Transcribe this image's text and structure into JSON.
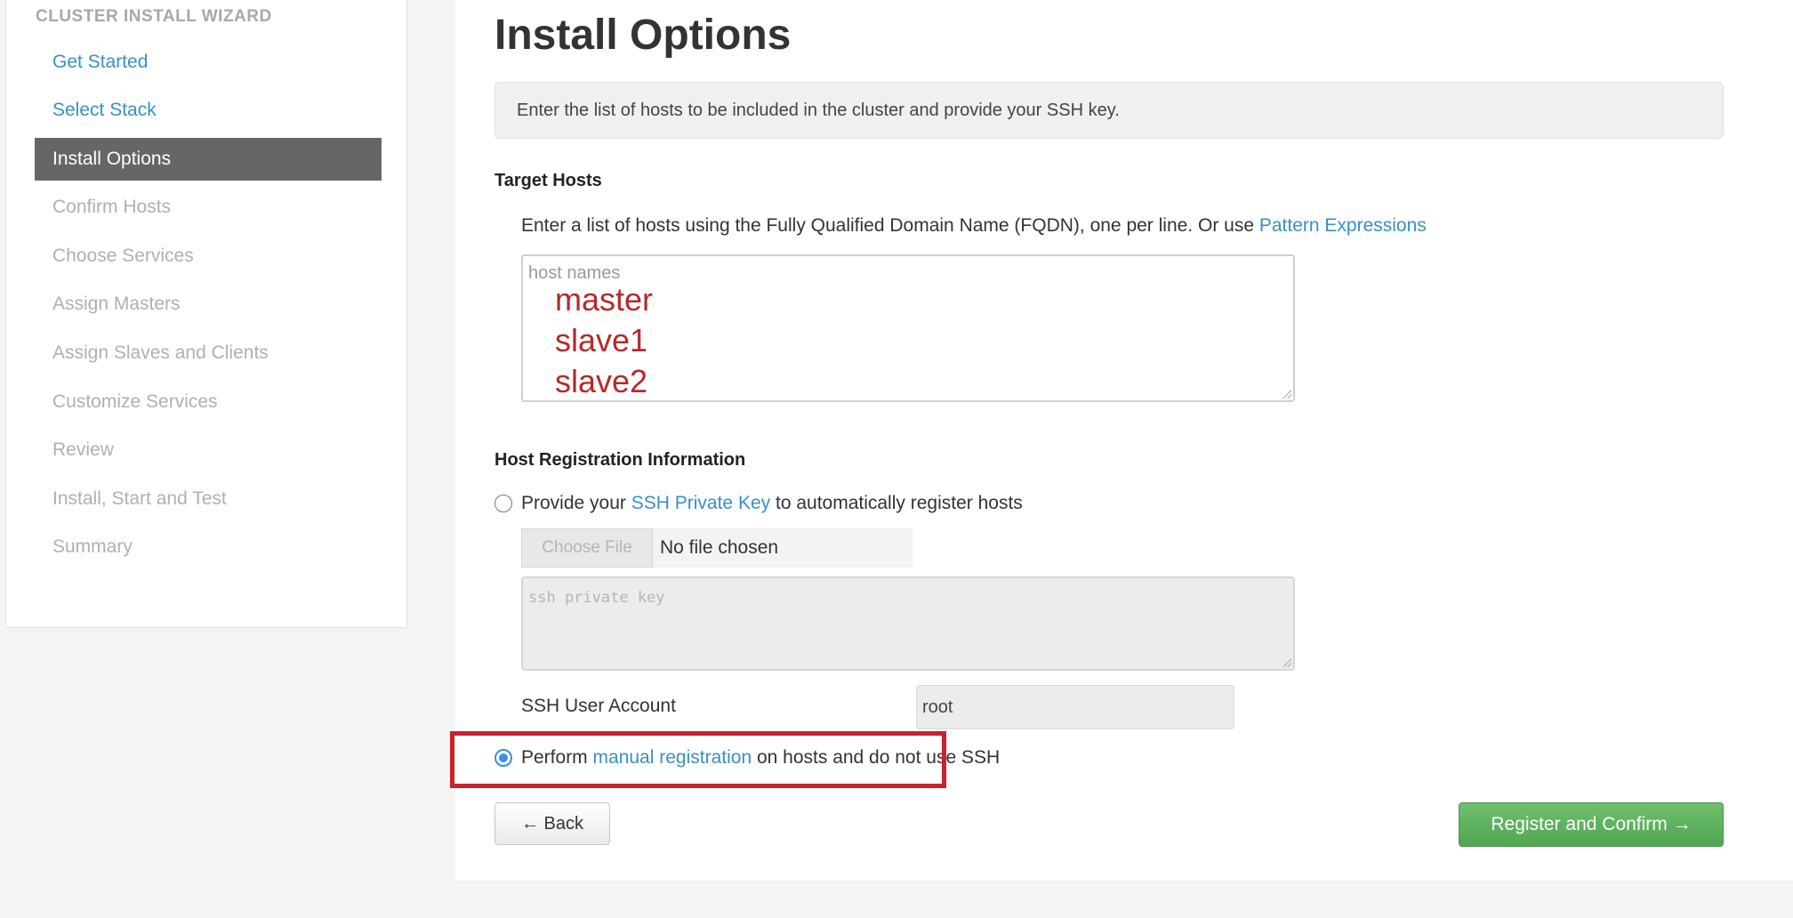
{
  "sidebar": {
    "header": "CLUSTER INSTALL WIZARD",
    "items": [
      {
        "label": "Get Started"
      },
      {
        "label": "Select Stack"
      },
      {
        "label": "Install Options"
      },
      {
        "label": "Confirm Hosts"
      },
      {
        "label": "Choose Services"
      },
      {
        "label": "Assign Masters"
      },
      {
        "label": "Assign Slaves and Clients"
      },
      {
        "label": "Customize Services"
      },
      {
        "label": "Review"
      },
      {
        "label": "Install, Start and Test"
      },
      {
        "label": "Summary"
      }
    ],
    "active_item": "Install Options"
  },
  "main": {
    "title": "Install Options",
    "info": "Enter the list of hosts to be included in the cluster and provide your SSH key.",
    "target_hosts": {
      "title": "Target Hosts",
      "description_prefix": "Enter a list of hosts using the Fully Qualified Domain Name (FQDN), one per line. Or use",
      "description_link": "Pattern Expressions",
      "placeholder": "host names",
      "hosts": [
        "master",
        "slave1",
        "slave2"
      ]
    },
    "host_registration": {
      "title": "Host Registration Information",
      "option_ssh": {
        "prefix": "Provide your",
        "link": "SSH Private Key",
        "suffix": "to automatically register hosts",
        "selected": false
      },
      "choose_file_label": "Choose File",
      "no_file_text": "No file chosen",
      "ssh_key_placeholder": "ssh private key",
      "ssh_user_label": "SSH User Account",
      "ssh_user_value": "root",
      "option_manual": {
        "prefix": "Perform",
        "link": "manual registration",
        "suffix": "on hosts and do not use SSH",
        "selected": true
      }
    },
    "buttons": {
      "back": "← Back",
      "register": "Register and Confirm →"
    }
  },
  "colors": {
    "link": "#3a8fc8",
    "active_nav_bg": "#666666",
    "register_button": "#5cb85c",
    "annotation_red": "#c8222c",
    "host_text_red": "#b52a2a"
  }
}
